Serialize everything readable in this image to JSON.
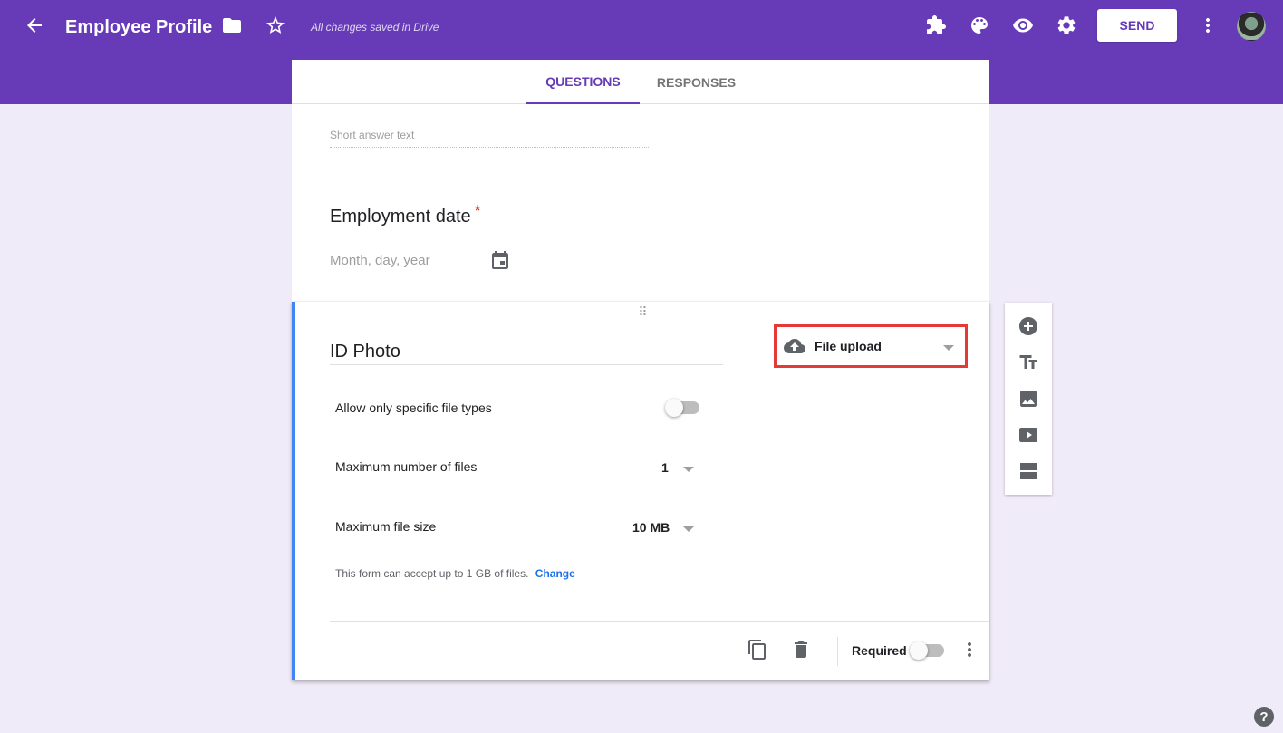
{
  "header": {
    "title": "Employee Profile",
    "save_status": "All changes saved in Drive",
    "send_label": "SEND",
    "icons": [
      "back-arrow-icon",
      "folder-icon",
      "star-icon",
      "puzzle-icon",
      "palette-icon",
      "eye-icon",
      "gear-icon",
      "more-vert-icon"
    ]
  },
  "tabs": [
    {
      "label": "QUESTIONS",
      "active": true
    },
    {
      "label": "RESPONSES",
      "active": false
    }
  ],
  "previous_questions": {
    "short_answer_placeholder": "Short answer text",
    "date_question": {
      "title": "Employment date",
      "required_mark": "*",
      "placeholder": "Month, day, year"
    }
  },
  "active_question": {
    "title": "ID Photo",
    "type": "File upload",
    "settings": {
      "allow_types_label": "Allow only specific file types",
      "allow_types_on": false,
      "max_files_label": "Maximum number of files",
      "max_files_value": "1",
      "max_size_label": "Maximum file size",
      "max_size_value": "10 MB"
    },
    "limit_note": "This form can accept up to 1 GB of files.",
    "change_link": "Change",
    "required_label": "Required",
    "required_on": false
  },
  "side_toolbar": [
    "add-question-icon",
    "title-text-icon",
    "image-icon",
    "video-icon",
    "section-icon"
  ],
  "help_label": "?",
  "colors": {
    "brand": "#673ab7",
    "background": "#f0ebf8",
    "active_border": "#4285f4",
    "highlight": "#e53935",
    "link": "#1a73e8"
  }
}
